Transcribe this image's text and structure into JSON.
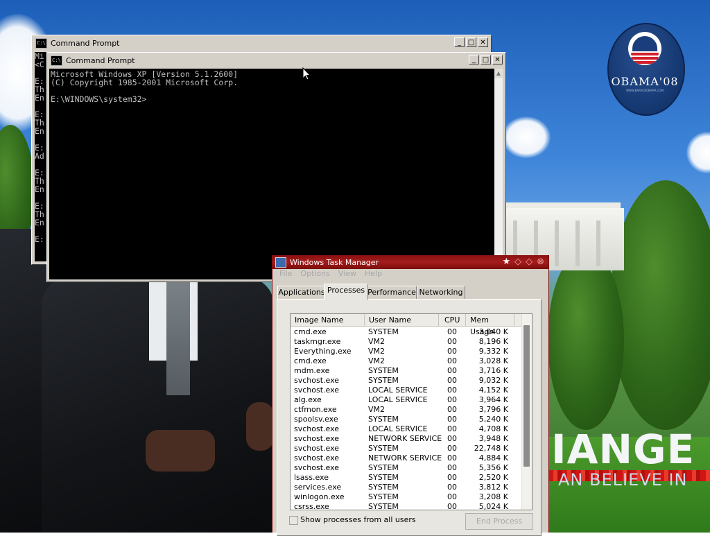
{
  "desktop": {
    "campaign_logo": {
      "text": "OBAMA'08",
      "subtext": "WWW.BARACKOBAMA.COM"
    },
    "slogan_1": "IANGE",
    "slogan_2": "AN BELIEVE IN"
  },
  "cmd_back": {
    "title": "Command Prompt",
    "icon": "cmd-icon",
    "lines": [
      "Mi",
      "<C",
      "",
      "E:",
      "Th",
      "En",
      "",
      "E:",
      "Th",
      "En",
      "",
      "E:",
      "Ad",
      "",
      "E:",
      "Th",
      "En",
      "",
      "E:",
      "Th",
      "En",
      "",
      "E:"
    ]
  },
  "cmd_front": {
    "title": "Command Prompt",
    "icon": "cmd-icon",
    "line1": "Microsoft Windows XP [Version 5.1.2600]",
    "line2": "(C) Copyright 1985-2001 Microsoft Corp.",
    "line3": "",
    "line4": "E:\\WINDOWS\\system32>"
  },
  "taskmgr": {
    "title": "Windows Task Manager",
    "menu": [
      "File",
      "Options",
      "View",
      "Help"
    ],
    "tabs": [
      "Applications",
      "Processes",
      "Performance",
      "Networking"
    ],
    "active_tab": "Processes",
    "columns": [
      "Image Name",
      "User Name",
      "CPU",
      "Mem Usage"
    ],
    "rows": [
      [
        "cmd.exe",
        "SYSTEM",
        "00",
        "3,040 K"
      ],
      [
        "taskmgr.exe",
        "VM2",
        "00",
        "8,196 K"
      ],
      [
        "Everything.exe",
        "VM2",
        "00",
        "9,332 K"
      ],
      [
        "cmd.exe",
        "VM2",
        "00",
        "3,028 K"
      ],
      [
        "mdm.exe",
        "SYSTEM",
        "00",
        "3,716 K"
      ],
      [
        "svchost.exe",
        "SYSTEM",
        "00",
        "9,032 K"
      ],
      [
        "svchost.exe",
        "LOCAL SERVICE",
        "00",
        "4,152 K"
      ],
      [
        "alg.exe",
        "LOCAL SERVICE",
        "00",
        "3,964 K"
      ],
      [
        "ctfmon.exe",
        "VM2",
        "00",
        "3,796 K"
      ],
      [
        "spoolsv.exe",
        "SYSTEM",
        "00",
        "5,240 K"
      ],
      [
        "svchost.exe",
        "LOCAL SERVICE",
        "00",
        "4,708 K"
      ],
      [
        "svchost.exe",
        "NETWORK SERVICE",
        "00",
        "3,948 K"
      ],
      [
        "svchost.exe",
        "SYSTEM",
        "00",
        "22,748 K"
      ],
      [
        "svchost.exe",
        "NETWORK SERVICE",
        "00",
        "4,884 K"
      ],
      [
        "svchost.exe",
        "SYSTEM",
        "00",
        "5,356 K"
      ],
      [
        "lsass.exe",
        "SYSTEM",
        "00",
        "2,520 K"
      ],
      [
        "services.exe",
        "SYSTEM",
        "00",
        "3,812 K"
      ],
      [
        "winlogon.exe",
        "SYSTEM",
        "00",
        "3,208 K"
      ],
      [
        "csrss.exe",
        "SYSTEM",
        "00",
        "5,024 K"
      ]
    ],
    "show_all_label": "Show processes from all users",
    "end_process_label": "End Process"
  },
  "colors": {
    "console_bg": "#000000",
    "console_fg": "#c0c0c0",
    "taskmgr_title": "#8b1010"
  }
}
